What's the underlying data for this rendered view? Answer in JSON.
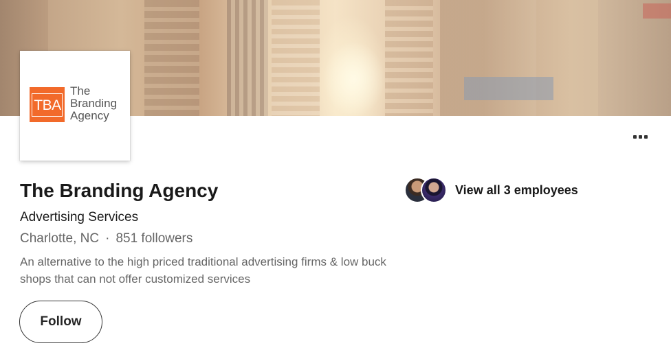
{
  "company": {
    "name": "The Branding Agency",
    "industry": "Advertising Services",
    "location": "Charlotte, NC",
    "separator": "·",
    "followers": "851 followers",
    "tagline": "An alternative to the high priced traditional advertising firms & low buck shops that can not offer customized services"
  },
  "logo": {
    "mark": "TBA",
    "line1": "The",
    "line2": "Branding",
    "line3": "Agency",
    "accent_color": "#f26a2a"
  },
  "actions": {
    "follow_label": "Follow",
    "more_icon": "more-horizontal-icon"
  },
  "employees": {
    "label": "View all 3 employees"
  }
}
